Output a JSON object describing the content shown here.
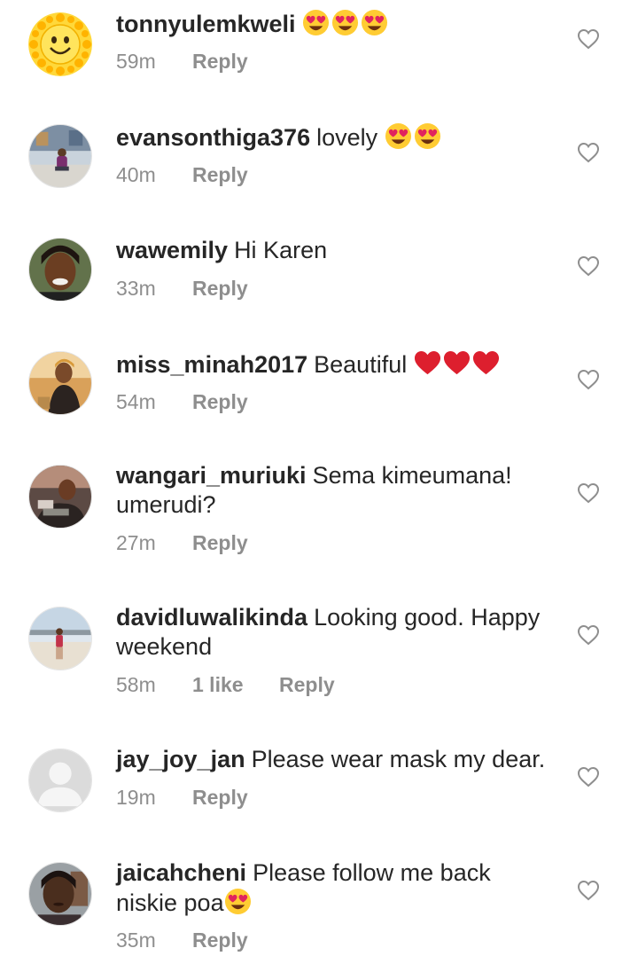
{
  "comments": [
    {
      "username": "tonnyulemkweli",
      "text": "",
      "emojis": [
        "heart-eyes",
        "heart-eyes",
        "heart-eyes"
      ],
      "time": "59m",
      "likes": "",
      "reply": "Reply",
      "avatar": "sun-emoji"
    },
    {
      "username": "evansonthiga376",
      "text": "lovely",
      "emojis": [
        "heart-eyes",
        "heart-eyes"
      ],
      "time": "40m",
      "likes": "",
      "reply": "Reply",
      "avatar": "photo"
    },
    {
      "username": "wawemily",
      "text": "Hi Karen",
      "emojis": [],
      "time": "33m",
      "likes": "",
      "reply": "Reply",
      "avatar": "photo"
    },
    {
      "username": "miss_minah2017",
      "text": "Beautiful",
      "emojis": [
        "red-heart",
        "red-heart",
        "red-heart"
      ],
      "time": "54m",
      "likes": "",
      "reply": "Reply",
      "avatar": "photo"
    },
    {
      "username": "wangari_muriuki",
      "text": "Sema kimeumana! umerudi?",
      "emojis": [],
      "time": "27m",
      "likes": "",
      "reply": "Reply",
      "avatar": "photo"
    },
    {
      "username": "davidluwalikinda",
      "text": "Looking good. Happy weekend",
      "emojis": [],
      "time": "58m",
      "likes": "1 like",
      "reply": "Reply",
      "avatar": "photo"
    },
    {
      "username": "jay_joy_jan",
      "text": "Please wear mask my dear.",
      "emojis": [],
      "time": "19m",
      "likes": "",
      "reply": "Reply",
      "avatar": "default-user"
    },
    {
      "username": "jaicahcheni",
      "text": "Please follow me back niskie poa",
      "emojis": [
        "heart-eyes"
      ],
      "time": "35m",
      "likes": "",
      "reply": "Reply",
      "avatar": "photo"
    }
  ],
  "colors": {
    "text": "#262626",
    "meta": "#8e8e8e",
    "heart_outline": "#8e8e8e",
    "emoji_face": "#ffcc33",
    "emoji_heart": "#e0245e"
  },
  "icons": {
    "like": "heart-outline-icon"
  }
}
